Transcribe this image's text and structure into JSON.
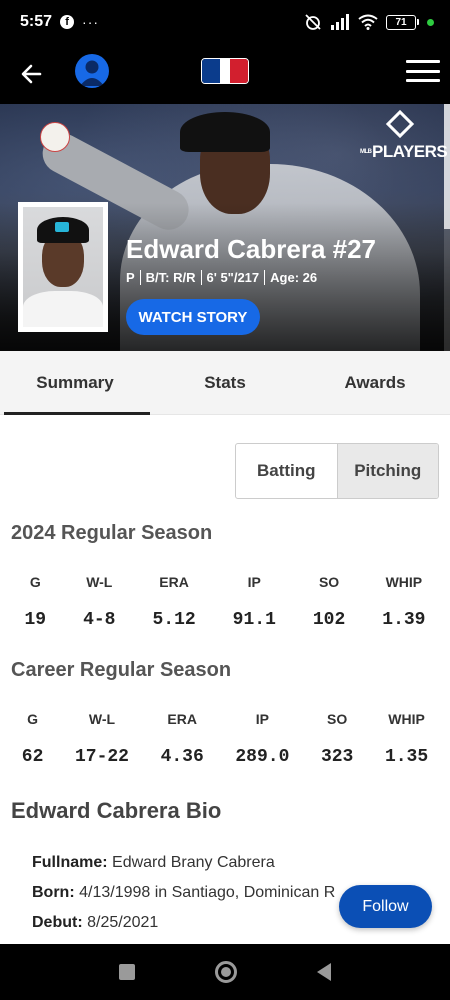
{
  "status_bar": {
    "time": "5:57",
    "fb_glyph": "f",
    "dots": "···",
    "battery": "71"
  },
  "header": {
    "icons": [
      "back-arrow-icon",
      "profile-icon",
      "mlb-logo",
      "hamburger-menu-icon"
    ]
  },
  "hero": {
    "players_logo_small": "MLB",
    "players_logo_text": "PLAYERS",
    "name": "Edward Cabrera #27",
    "meta": {
      "position": "P",
      "bats_throws": "B/T: R/R",
      "height_weight": "6' 5\"/217",
      "age": "Age: 26"
    },
    "watch_story": "WATCH STORY"
  },
  "tabs": [
    {
      "label": "Summary",
      "active": true
    },
    {
      "label": "Stats",
      "active": false
    },
    {
      "label": "Awards",
      "active": false
    }
  ],
  "toggle": {
    "batting": "Batting",
    "pitching": "Pitching",
    "selected": "Pitching"
  },
  "season": {
    "title": "2024 Regular Season",
    "headers": [
      "G",
      "W-L",
      "ERA",
      "IP",
      "SO",
      "WHIP"
    ],
    "values": [
      "19",
      "4-8",
      "5.12",
      "91.1",
      "102",
      "1.39"
    ]
  },
  "career": {
    "title": "Career Regular Season",
    "headers": [
      "G",
      "W-L",
      "ERA",
      "IP",
      "SO",
      "WHIP"
    ],
    "values": [
      "62",
      "17-22",
      "4.36",
      "289.0",
      "323",
      "1.35"
    ]
  },
  "bio": {
    "title": "Edward Cabrera Bio",
    "fullname_label": "Fullname:",
    "fullname": "Edward Brany Cabrera",
    "born_label": "Born:",
    "born": "4/13/1998 in Santiago, Dominican R",
    "debut_label": "Debut:",
    "debut": "8/25/2021"
  },
  "follow": "Follow"
}
